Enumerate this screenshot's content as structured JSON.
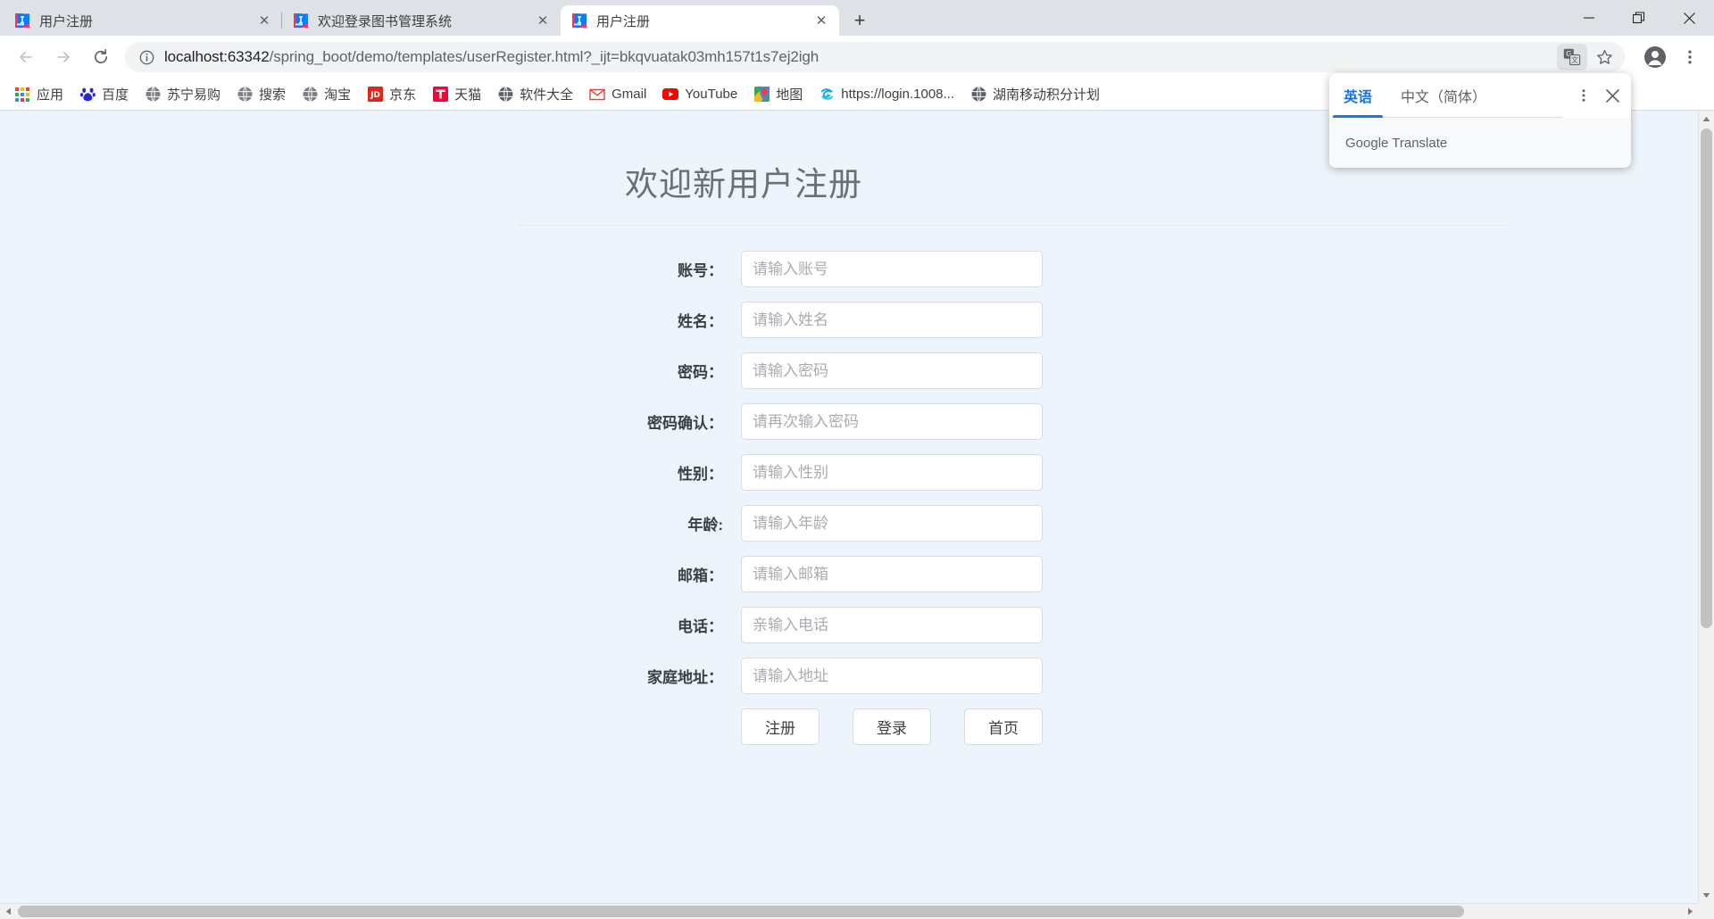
{
  "browser": {
    "tabs": [
      {
        "title": "用户注册",
        "favicon": "intellij-icon",
        "active": false
      },
      {
        "title": "欢迎登录图书管理系统",
        "favicon": "intellij-icon",
        "active": false
      },
      {
        "title": "用户注册",
        "favicon": "intellij-icon",
        "active": true
      }
    ],
    "new_tab_label": "+",
    "close_label": "✕",
    "window_controls": {
      "minimize": "minimize-icon",
      "maximize": "maximize-icon",
      "close": "close-icon"
    },
    "nav": {
      "back": "back-arrow-icon",
      "forward": "forward-arrow-icon",
      "reload": "reload-icon"
    },
    "omnibox": {
      "info_icon": "page-info-icon",
      "host": "localhost:63342",
      "path": "/spring_boot/demo/templates/userRegister.html?_ijt=bkqvuatak03mh157t1s7ej2igh",
      "translate_icon": "translate-icon",
      "bookmark_icon": "star-icon",
      "profile_icon": "avatar-icon",
      "menu_icon": "kebab-menu-icon"
    },
    "bookmarks": [
      {
        "label": "应用",
        "icon": "apps-grid-icon"
      },
      {
        "label": "百度",
        "icon": "baidu-icon"
      },
      {
        "label": "苏宁易购",
        "icon": "globe-icon"
      },
      {
        "label": "搜索",
        "icon": "globe-icon"
      },
      {
        "label": "淘宝",
        "icon": "globe-icon"
      },
      {
        "label": "京东",
        "icon": "jd-icon"
      },
      {
        "label": "天猫",
        "icon": "tmall-icon"
      },
      {
        "label": "软件大全",
        "icon": "globe-icon"
      },
      {
        "label": "Gmail",
        "icon": "gmail-icon"
      },
      {
        "label": "YouTube",
        "icon": "youtube-icon"
      },
      {
        "label": "地图",
        "icon": "maps-icon"
      },
      {
        "label": "https://login.1008...",
        "icon": "swirl-icon"
      },
      {
        "label": "湖南移动积分计划",
        "icon": "globe-icon"
      }
    ]
  },
  "translate_popup": {
    "tabs": [
      {
        "label": "英语",
        "active": true
      },
      {
        "label": "中文（简体）",
        "active": false
      }
    ],
    "menu_icon": "kebab-menu-icon",
    "close_icon": "close-icon",
    "footer": "Google Translate",
    "accent_color": "#1a73e8"
  },
  "page": {
    "title": "欢迎新用户注册",
    "background_color": "#eef4fb",
    "fields": [
      {
        "label": "账号：",
        "placeholder": "请输入账号",
        "value": "",
        "name": "account"
      },
      {
        "label": "姓名：",
        "placeholder": "请输入姓名",
        "value": "",
        "name": "name"
      },
      {
        "label": "密码：",
        "placeholder": "请输入密码",
        "value": "",
        "name": "password"
      },
      {
        "label": "密码确认：",
        "placeholder": "请再次输入密码",
        "value": "",
        "name": "password-confirm"
      },
      {
        "label": "性别：",
        "placeholder": "请输入性别",
        "value": "",
        "name": "gender"
      },
      {
        "label": "年龄:",
        "placeholder": "请输入年龄",
        "value": "",
        "name": "age"
      },
      {
        "label": "邮箱：",
        "placeholder": "请输入邮箱",
        "value": "",
        "name": "email"
      },
      {
        "label": "电话：",
        "placeholder": "亲输入电话",
        "value": "",
        "name": "phone"
      },
      {
        "label": "家庭地址：",
        "placeholder": "请输入地址",
        "value": "",
        "name": "address"
      }
    ],
    "buttons": [
      {
        "label": "注册",
        "name": "register"
      },
      {
        "label": "登录",
        "name": "login"
      },
      {
        "label": "首页",
        "name": "home"
      }
    ]
  }
}
